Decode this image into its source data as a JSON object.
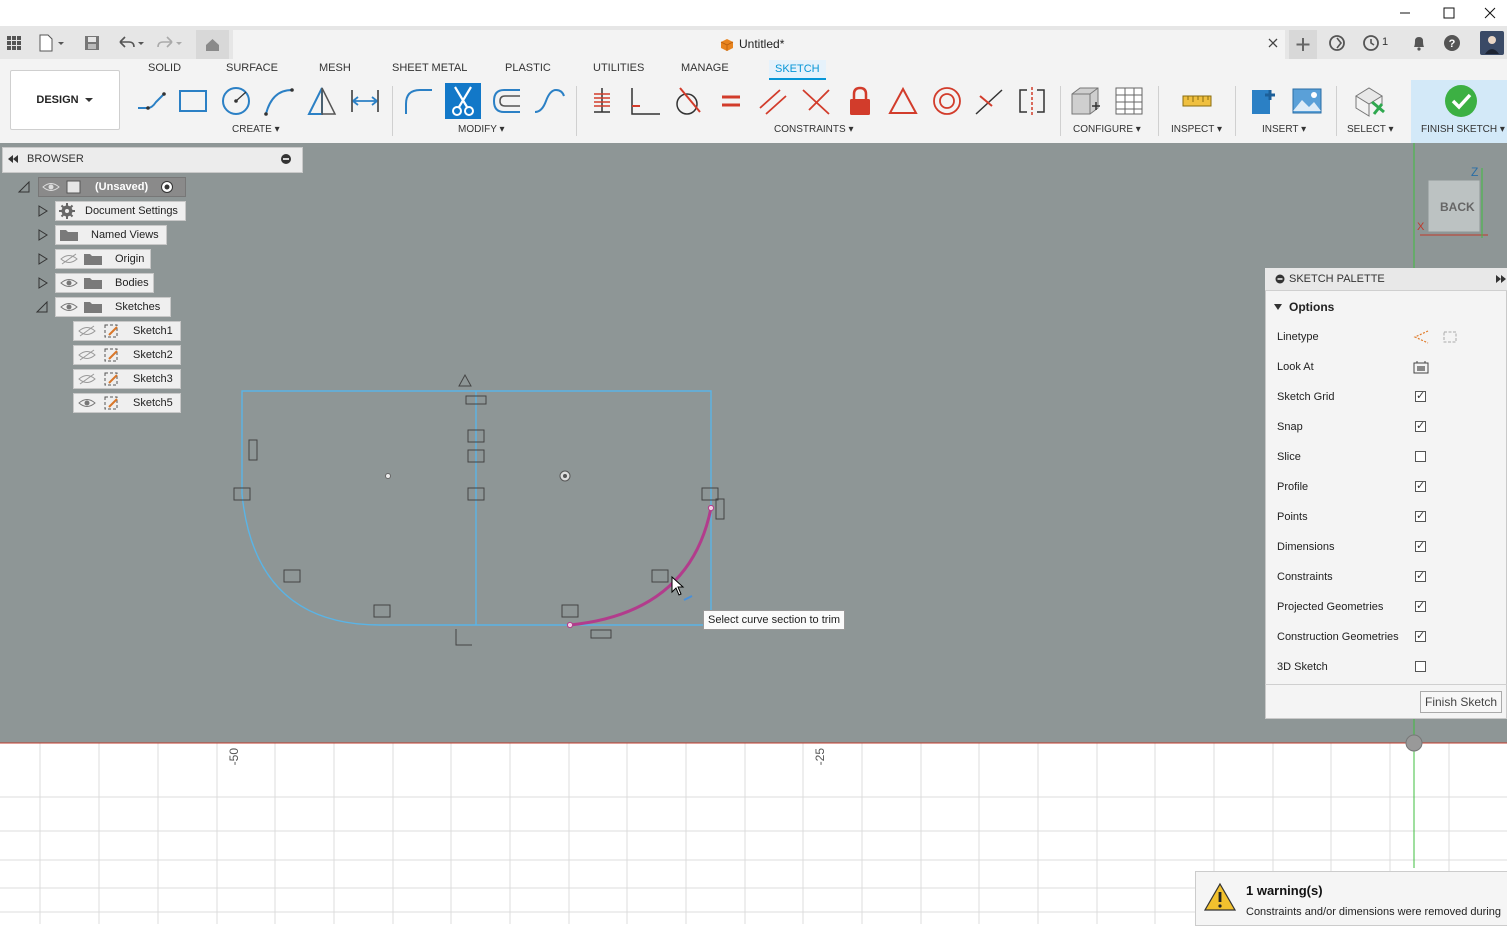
{
  "app": {
    "document_title": "Untitled*",
    "job_count": "1"
  },
  "ribbon": {
    "workspace": "DESIGN",
    "tabs": [
      "SOLID",
      "SURFACE",
      "MESH",
      "SHEET METAL",
      "PLASTIC",
      "UTILITIES",
      "MANAGE",
      "SKETCH"
    ],
    "groups": [
      "CREATE ▾",
      "MODIFY ▾",
      "CONSTRAINTS ▾",
      "CONFIGURE ▾",
      "INSPECT ▾",
      "INSERT ▾",
      "SELECT ▾",
      "FINISH SKETCH ▾"
    ]
  },
  "browser": {
    "title": "BROWSER",
    "root": "(Unsaved)",
    "nodes": [
      "Document Settings",
      "Named Views",
      "Origin",
      "Bodies",
      "Sketches"
    ],
    "sketches": [
      "Sketch1",
      "Sketch2",
      "Sketch3",
      "Sketch5"
    ]
  },
  "canvas": {
    "tooltip": "Select curve section to trim",
    "ruler_labels": [
      "-50",
      "-25"
    ],
    "viewcube_face": "BACK",
    "axis_z": "Z",
    "axis_x": "X"
  },
  "palette": {
    "title": "SKETCH PALETTE",
    "section": "Options",
    "rows": [
      {
        "label": "Linetype"
      },
      {
        "label": "Look At"
      },
      {
        "label": "Sketch Grid",
        "checked": true
      },
      {
        "label": "Snap",
        "checked": true
      },
      {
        "label": "Slice",
        "checked": false
      },
      {
        "label": "Profile",
        "checked": true
      },
      {
        "label": "Points",
        "checked": true
      },
      {
        "label": "Dimensions",
        "checked": true
      },
      {
        "label": "Constraints",
        "checked": true
      },
      {
        "label": "Projected Geometries",
        "checked": true
      },
      {
        "label": "Construction Geometries",
        "checked": true
      },
      {
        "label": "3D Sketch",
        "checked": false
      }
    ],
    "finish_button": "Finish Sketch"
  },
  "warning": {
    "title": "1 warning(s)",
    "message": "Constraints and/or dimensions were removed during"
  },
  "colors": {
    "accent": "#0696d7",
    "sketch_line": "#5ab4e6",
    "selected_curve": "#b23c8c",
    "canvas": "#8e9696"
  }
}
